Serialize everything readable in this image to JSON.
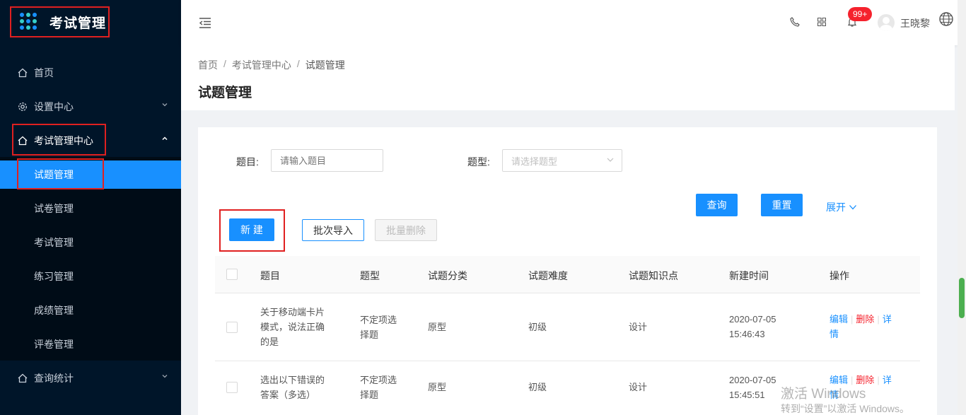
{
  "app": {
    "title": "考试管理"
  },
  "sidebar": {
    "items": [
      {
        "label": "首页"
      },
      {
        "label": "设置中心"
      },
      {
        "label": "考试管理中心"
      },
      {
        "label": "查询统计"
      }
    ],
    "sub_items": [
      {
        "label": "试题管理"
      },
      {
        "label": "试卷管理"
      },
      {
        "label": "考试管理"
      },
      {
        "label": "练习管理"
      },
      {
        "label": "成绩管理"
      },
      {
        "label": "评卷管理"
      }
    ]
  },
  "header": {
    "badge": "99+",
    "username": "王晓黎"
  },
  "breadcrumb": [
    "首页",
    "/",
    "考试管理中心",
    "/",
    "试题管理"
  ],
  "page_title": "试题管理",
  "filters": {
    "question_label": "题目:",
    "question_placeholder": "请输入题目",
    "type_label": "题型:",
    "type_placeholder": "请选择题型"
  },
  "buttons": {
    "query": "查询",
    "reset": "重置",
    "expand": "展开",
    "new": "新 建",
    "batch_import": "批次导入",
    "batch_delete": "批量删除"
  },
  "table": {
    "columns": [
      "题目",
      "题型",
      "试题分类",
      "试题难度",
      "试题知识点",
      "新建时间",
      "操作"
    ],
    "rows": [
      {
        "title_lines": [
          "关于移动端卡片",
          "模式，说法正确",
          "的是"
        ],
        "type_lines": [
          "不定项选",
          "择题"
        ],
        "category": "原型",
        "difficulty": "初级",
        "knowledge": "设计",
        "time_lines": [
          "2020-07-05",
          "15:46:43"
        ]
      },
      {
        "title_lines": [
          "选出以下错误的",
          "答案（多选）"
        ],
        "type_lines": [
          "不定项选",
          "择题"
        ],
        "category": "原型",
        "difficulty": "初级",
        "knowledge": "设计",
        "time_lines": [
          "2020-07-05",
          "15:45:51"
        ]
      }
    ],
    "actions": {
      "edit": "编辑",
      "sep": "|",
      "delete": "删除",
      "detail_1": "详",
      "detail_2": "情"
    }
  },
  "watermark": {
    "line1": "激活 Windows",
    "line2": "转到“设置”以激活 Windows。"
  }
}
